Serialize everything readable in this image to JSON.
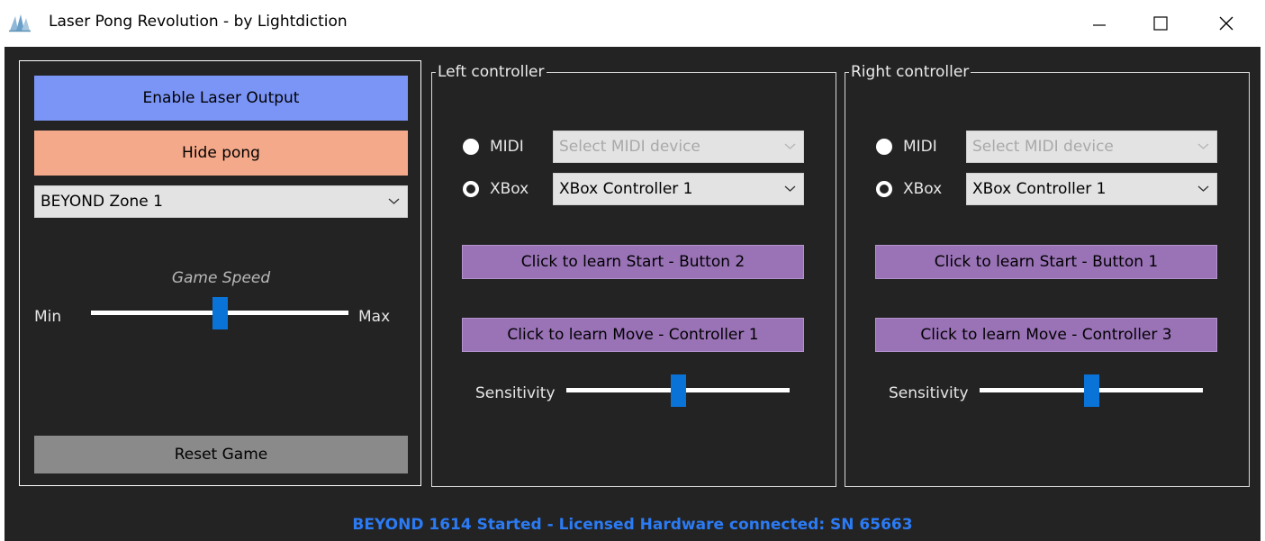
{
  "window": {
    "title": "Laser Pong Revolution - by Lightdiction",
    "icon": "app-logo-icon"
  },
  "controls": {
    "enable_laser_label": "Enable Laser Output",
    "hide_pong_label": "Hide pong",
    "zone_selected": "BEYOND Zone 1",
    "game_speed_label": "Game Speed",
    "speed_min": "Min",
    "speed_max": "Max",
    "speed_value": 0.5,
    "reset_label": "Reset Game"
  },
  "left_controller": {
    "legend": "Left controller",
    "midi_label": "MIDI",
    "midi_placeholder": "Select MIDI device",
    "xbox_label": "XBox",
    "xbox_selected": "XBox Controller 1",
    "input_mode": "XBox",
    "learn_start_label": "Click to learn Start - Button 2",
    "learn_move_label": "Click to learn Move - Controller 1",
    "sensitivity_label": "Sensitivity",
    "sensitivity_value": 0.5
  },
  "right_controller": {
    "legend": "Right controller",
    "midi_label": "MIDI",
    "midi_placeholder": "Select MIDI device",
    "xbox_label": "XBox",
    "xbox_selected": "XBox Controller 1",
    "input_mode": "XBox",
    "learn_start_label": "Click to learn Start - Button 1",
    "learn_move_label": "Click to learn Move - Controller 3",
    "sensitivity_label": "Sensitivity",
    "sensitivity_value": 0.5
  },
  "status": {
    "text": "BEYOND 1614 Started - Licensed Hardware connected: SN 65663"
  },
  "colors": {
    "background": "#232323",
    "enable_button": "#7b95f7",
    "hide_button": "#f4a98a",
    "reset_button": "#8a8a8a",
    "learn_button": "#9a73b7",
    "slider_thumb": "#0a73d8",
    "status_text": "#2b7bf5"
  }
}
